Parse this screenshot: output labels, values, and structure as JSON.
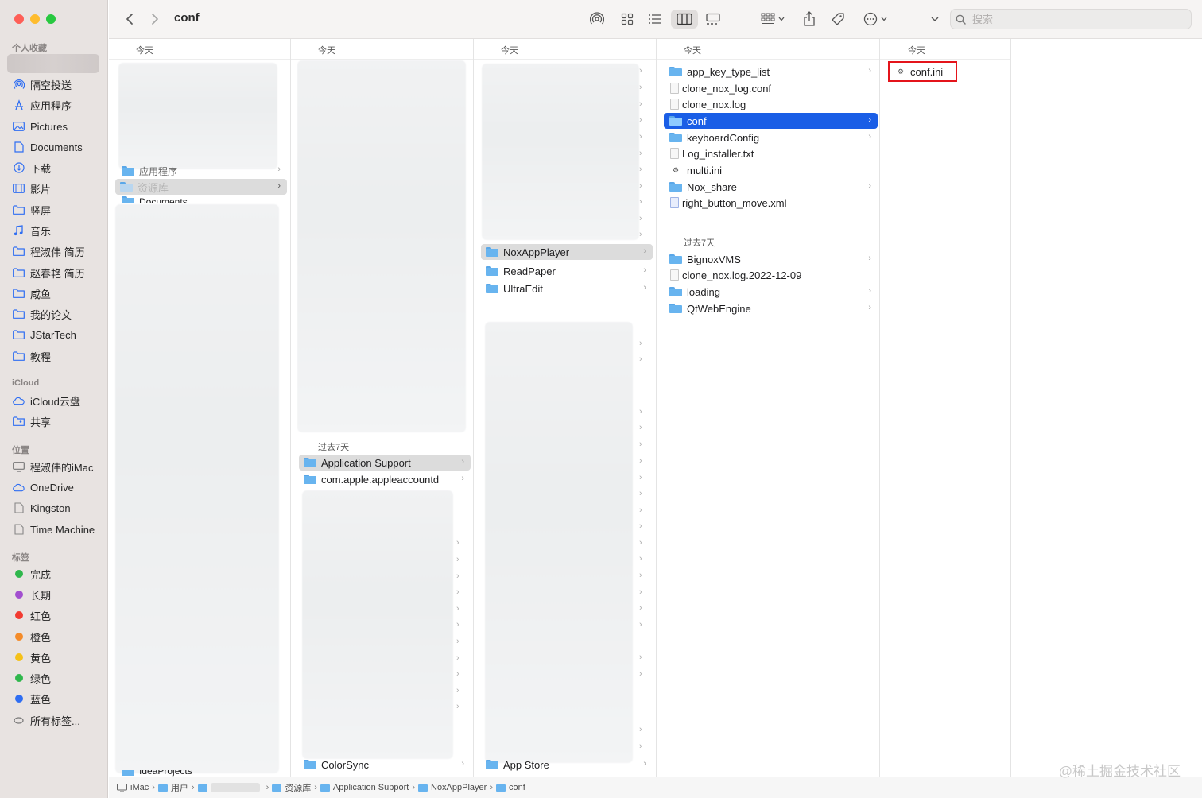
{
  "window": {
    "title": "conf"
  },
  "toolbar": {
    "search_placeholder": "搜索"
  },
  "sidebar": {
    "favorites_header": "个人收藏",
    "favorites": [
      {
        "label": "隔空投送",
        "icon": "airdrop-icon"
      },
      {
        "label": "应用程序",
        "icon": "applications-icon"
      },
      {
        "label": "Pictures",
        "icon": "pictures-icon"
      },
      {
        "label": "Documents",
        "icon": "document-icon"
      },
      {
        "label": "下载",
        "icon": "download-icon"
      },
      {
        "label": "影片",
        "icon": "movies-icon"
      },
      {
        "label": "竖屏",
        "icon": "folder-icon"
      },
      {
        "label": "音乐",
        "icon": "music-icon"
      },
      {
        "label": "程淑伟 简历",
        "icon": "folder-icon"
      },
      {
        "label": "赵春艳 简历",
        "icon": "folder-icon"
      },
      {
        "label": "咸鱼",
        "icon": "folder-icon"
      },
      {
        "label": "我的论文",
        "icon": "folder-icon"
      },
      {
        "label": "JStarTech",
        "icon": "folder-icon"
      },
      {
        "label": "教程",
        "icon": "folder-icon"
      }
    ],
    "icloud_header": "iCloud",
    "icloud": [
      {
        "label": "iCloud云盘",
        "icon": "cloud-icon"
      },
      {
        "label": "共享",
        "icon": "shared-folder-icon"
      }
    ],
    "locations_header": "位置",
    "locations": [
      {
        "label": "程淑伟的iMac",
        "icon": "display-icon"
      },
      {
        "label": "OneDrive",
        "icon": "cloud-icon"
      },
      {
        "label": "Kingston",
        "icon": "drive-icon"
      },
      {
        "label": "Time Machine",
        "icon": "drive-icon"
      }
    ],
    "tags_header": "标签",
    "tags": [
      {
        "label": "完成",
        "color": "#2fb74c"
      },
      {
        "label": "长期",
        "color": "#a24fcf"
      },
      {
        "label": "红色",
        "color": "#f23b31"
      },
      {
        "label": "橙色",
        "color": "#f48b29"
      },
      {
        "label": "黄色",
        "color": "#f5c118"
      },
      {
        "label": "绿色",
        "color": "#2fb74c"
      },
      {
        "label": "蓝色",
        "color": "#2f6ef2"
      }
    ],
    "all_tags": "所有标签..."
  },
  "columns": {
    "today": "今天",
    "past7": "过去7天",
    "col1": {
      "items": [
        "应用程序",
        "资源库",
        "Documents",
        "IdeaProjects"
      ]
    },
    "col2": {
      "past7_items": [
        "Application Support",
        "com.apple.appleaccountd"
      ],
      "bottom_item": "ColorSync"
    },
    "col3": {
      "items": [
        "NoxAppPlayer",
        "ReadPaper",
        "UltraEdit"
      ],
      "bottom_item": "App Store"
    },
    "col4": {
      "today_items": [
        {
          "label": "app_key_type_list",
          "kind": "folder",
          "chevron": true
        },
        {
          "label": "clone_nox_log.conf",
          "kind": "doc",
          "chevron": false
        },
        {
          "label": "clone_nox.log",
          "kind": "doc",
          "chevron": false
        },
        {
          "label": "conf",
          "kind": "folder",
          "chevron": true,
          "selected": true
        },
        {
          "label": "keyboardConfig",
          "kind": "folder",
          "chevron": true
        },
        {
          "label": "Log_installer.txt",
          "kind": "doc",
          "chevron": false
        },
        {
          "label": "multi.ini",
          "kind": "gear",
          "chevron": false
        },
        {
          "label": "Nox_share",
          "kind": "folder",
          "chevron": true
        },
        {
          "label": "right_button_move.xml",
          "kind": "xml",
          "chevron": false
        }
      ],
      "past7_items": [
        {
          "label": "BignoxVMS",
          "kind": "folder",
          "chevron": true
        },
        {
          "label": "clone_nox.log.2022-12-09",
          "kind": "doc",
          "chevron": false
        },
        {
          "label": "loading",
          "kind": "folder",
          "chevron": true
        },
        {
          "label": "QtWebEngine",
          "kind": "folder",
          "chevron": true
        }
      ]
    },
    "col5": {
      "items": [
        "conf.ini"
      ]
    }
  },
  "pathbar": [
    "iMac",
    "用户",
    "资源库",
    "Application Support",
    "NoxAppPlayer",
    "conf"
  ],
  "watermark": "@稀土掘金技术社区"
}
